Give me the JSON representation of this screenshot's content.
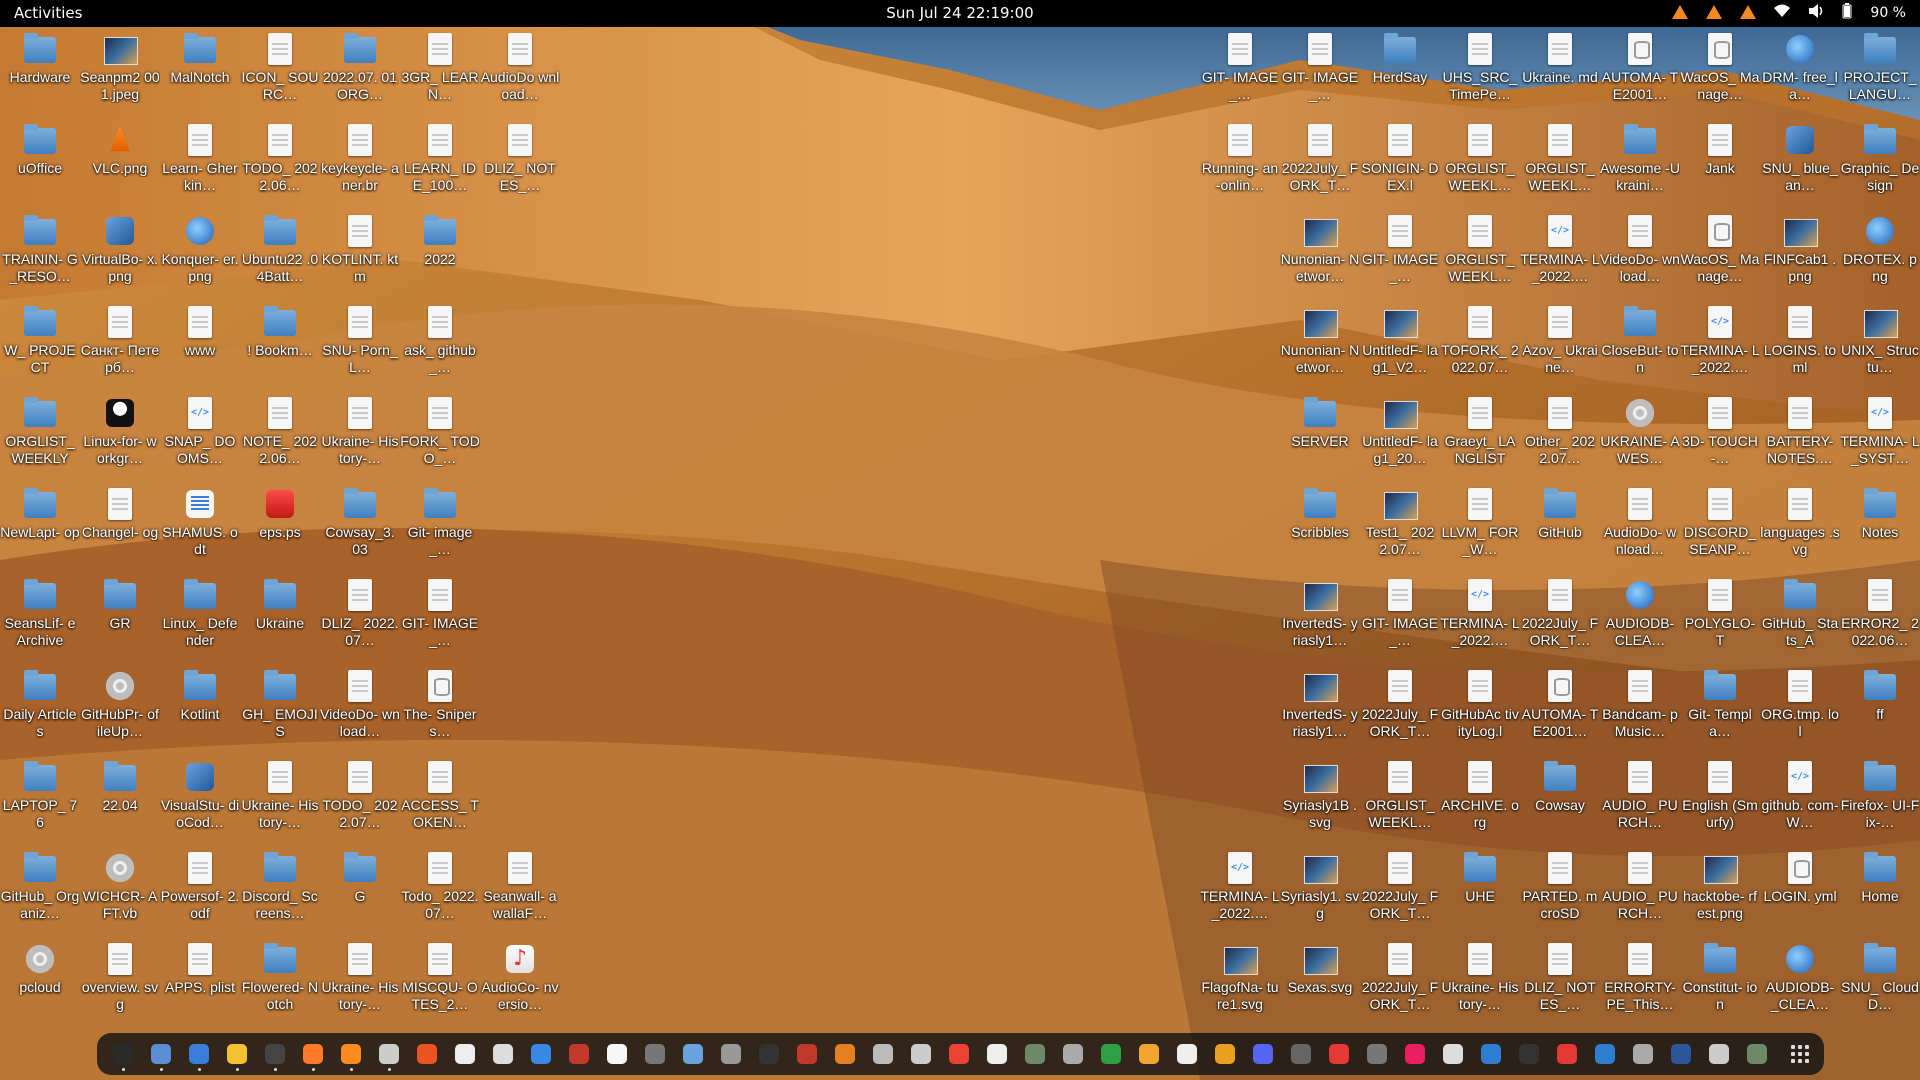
{
  "topbar": {
    "activities": "Activities",
    "clock": "Sun Jul 24  22:19:00",
    "tray_icons": [
      "warning-icon",
      "warning-icon",
      "warning-icon",
      "wifi-icon",
      "volume-icon",
      "battery-icon"
    ],
    "battery": "90 %"
  },
  "colors": {
    "sky": "#3f6d98",
    "sand_light": "#e4a556",
    "sand_dark": "#8f4d1b",
    "dock": "#141414",
    "folder": "#4a8bd0"
  },
  "desktop_left": [
    {
      "label": "Hardware",
      "icon": "folder"
    },
    {
      "label": "Seanpm2 001.jpeg",
      "icon": "image"
    },
    {
      "label": "MalNotch",
      "icon": "folder"
    },
    {
      "label": "ICON_ SOURC…",
      "icon": "doc"
    },
    {
      "label": "2022.07. 01ORG…",
      "icon": "folder"
    },
    {
      "label": "3GR_ LEARN…",
      "icon": "doc"
    },
    {
      "label": "AudioDo wnload…",
      "icon": "doc"
    },
    {
      "label": "uOffice",
      "icon": "folder"
    },
    {
      "label": "VLC.png",
      "icon": "vlc"
    },
    {
      "label": "Learn- Gherkin…",
      "icon": "doc"
    },
    {
      "label": "TODO_ 2022.06…",
      "icon": "doc"
    },
    {
      "label": "keykeycle- aner.br",
      "icon": "doc"
    },
    {
      "label": "LEARN_ IDE_100…",
      "icon": "doc"
    },
    {
      "label": "DLIZ_ NOTES_…",
      "icon": "doc"
    },
    {
      "label": "TRAININ- G_RESO…",
      "icon": "folder"
    },
    {
      "label": "VirtualBo- x.png",
      "icon": "cube"
    },
    {
      "label": "Konquer- er.png",
      "icon": "globe"
    },
    {
      "label": "Ubuntu22 .04Batt…",
      "icon": "folder"
    },
    {
      "label": "KOTLINT. ktm",
      "icon": "doc"
    },
    {
      "label": "2022",
      "icon": "folder"
    },
    {
      "label": "",
      "icon": "none"
    },
    {
      "label": "W_ PROJECT",
      "icon": "folder"
    },
    {
      "label": "Санкт- Петерб…",
      "icon": "doc"
    },
    {
      "label": "www",
      "icon": "doc"
    },
    {
      "label": "! Bookm…",
      "icon": "folder"
    },
    {
      "label": "SNU- Porn_L…",
      "icon": "doc"
    },
    {
      "label": "ask_ github_…",
      "icon": "doc"
    },
    {
      "label": "",
      "icon": "none"
    },
    {
      "label": "ORGLIST_ WEEKLY",
      "icon": "folder"
    },
    {
      "label": "Linux-for- workgr…",
      "icon": "tux"
    },
    {
      "label": "SNAP_ DOOMS…",
      "icon": "code"
    },
    {
      "label": "NOTE_ 2022.06…",
      "icon": "doc"
    },
    {
      "label": "Ukraine- History-…",
      "icon": "doc"
    },
    {
      "label": "FORK_ TODO_…",
      "icon": "doc"
    },
    {
      "label": "",
      "icon": "none"
    },
    {
      "label": "NewLapt- op",
      "icon": "folder"
    },
    {
      "label": "Changel- og",
      "icon": "doc"
    },
    {
      "label": "SHAMUS. odt",
      "icon": "bluedoc"
    },
    {
      "label": "eps.ps",
      "icon": "red"
    },
    {
      "label": "Cowsay_3. 03",
      "icon": "folder"
    },
    {
      "label": "Git- image_…",
      "icon": "folder"
    },
    {
      "label": "",
      "icon": "none"
    },
    {
      "label": "SeansLif- eArchive",
      "icon": "folder"
    },
    {
      "label": "GR",
      "icon": "folder"
    },
    {
      "label": "Linux_ Defender",
      "icon": "folder"
    },
    {
      "label": "Ukraine",
      "icon": "folder"
    },
    {
      "label": "DLIZ_ 2022.07…",
      "icon": "doc"
    },
    {
      "label": "GIT- IMAGE_…",
      "icon": "doc"
    },
    {
      "label": "",
      "icon": "none"
    },
    {
      "label": "Daily Articles",
      "icon": "folder"
    },
    {
      "label": "GitHubPr- ofileUp…",
      "icon": "gear"
    },
    {
      "label": "Kotlint",
      "icon": "folder"
    },
    {
      "label": "GH_ EMOJIS",
      "icon": "folder"
    },
    {
      "label": "VideoDo- wnload…",
      "icon": "doc"
    },
    {
      "label": "The- Snipers…",
      "icon": "db"
    },
    {
      "label": "",
      "icon": "none"
    },
    {
      "label": "LAPTOP_ 76",
      "icon": "folder"
    },
    {
      "label": "22.04",
      "icon": "folder"
    },
    {
      "label": "VisualStu- dioCod…",
      "icon": "cube"
    },
    {
      "label": "Ukraine- History-…",
      "icon": "doc"
    },
    {
      "label": "TODO_ 2022.07…",
      "icon": "doc"
    },
    {
      "label": "ACCESS_ TOKEN…",
      "icon": "doc"
    },
    {
      "label": "",
      "icon": "none"
    },
    {
      "label": "GitHub_ Organiz…",
      "icon": "folder"
    },
    {
      "label": "WICHCR- AFT.vb",
      "icon": "gear"
    },
    {
      "label": "Powersof- 2.odf",
      "icon": "doc"
    },
    {
      "label": "Discord_ Screens…",
      "icon": "folder"
    },
    {
      "label": "G",
      "icon": "folder"
    },
    {
      "label": "Todo_ 2022.07…",
      "icon": "doc"
    },
    {
      "label": "Seanwall- awallaF…",
      "icon": "doc"
    },
    {
      "label": "pcloud",
      "icon": "gear"
    },
    {
      "label": "overview. svg",
      "icon": "doc"
    },
    {
      "label": "APPS. plist",
      "icon": "doc"
    },
    {
      "label": "Flowered- Notch",
      "icon": "folder"
    },
    {
      "label": "Ukraine- History-…",
      "icon": "doc"
    },
    {
      "label": "MISCQU- OTES_2…",
      "icon": "doc"
    },
    {
      "label": "AudioCo- nversio…",
      "icon": "note"
    }
  ],
  "desktop_right": [
    {
      "label": "GIT- IMAGE_…",
      "icon": "doc"
    },
    {
      "label": "GIT- IMAGE_…",
      "icon": "doc"
    },
    {
      "label": "HerdSay",
      "icon": "folder"
    },
    {
      "label": "UHS_SRC_ TimePe…",
      "icon": "doc"
    },
    {
      "label": "Ukraine. md",
      "icon": "doc"
    },
    {
      "label": "AUTOMA- TE2001…",
      "icon": "db"
    },
    {
      "label": "WacOS_ Manage…",
      "icon": "db"
    },
    {
      "label": "DRM- free_la…",
      "icon": "globe"
    },
    {
      "label": "PROJECT_ LANGU…",
      "icon": "folder"
    },
    {
      "label": "Running- an-onlin…",
      "icon": "doc"
    },
    {
      "label": "2022July_ FORK_T…",
      "icon": "doc"
    },
    {
      "label": "SONICIN- DEX.l",
      "icon": "doc"
    },
    {
      "label": "ORGLIST_ WEEKL…",
      "icon": "doc"
    },
    {
      "label": "ORGLIST_ WEEKL…",
      "icon": "doc"
    },
    {
      "label": "Awesome -Ukraini…",
      "icon": "folder"
    },
    {
      "label": "Jank",
      "icon": "doc"
    },
    {
      "label": "SNU_ blue_an…",
      "icon": "cube"
    },
    {
      "label": "Graphic_ Design",
      "icon": "folder"
    },
    {
      "label": "",
      "icon": "none"
    },
    {
      "label": "Nunonian- Networ…",
      "icon": "image"
    },
    {
      "label": "GIT- IMAGE_…",
      "icon": "doc"
    },
    {
      "label": "ORGLIST_ WEEKL…",
      "icon": "doc"
    },
    {
      "label": "TERMINA- L_2022.…",
      "icon": "code"
    },
    {
      "label": "VideoDo- wnload…",
      "icon": "doc"
    },
    {
      "label": "WacOS_ Manage…",
      "icon": "db"
    },
    {
      "label": "FINFCab1 .png",
      "icon": "image"
    },
    {
      "label": "DROTEX. png",
      "icon": "globe"
    },
    {
      "label": "",
      "icon": "none"
    },
    {
      "label": "Nunonian- Networ…",
      "icon": "image"
    },
    {
      "label": "UntitledF- lag1_V2…",
      "icon": "image"
    },
    {
      "label": "TOFORK_ 2022.07…",
      "icon": "doc"
    },
    {
      "label": "Azov_ Ukraine…",
      "icon": "doc"
    },
    {
      "label": "CloseBut- ton",
      "icon": "folder"
    },
    {
      "label": "TERMINA- L_2022.…",
      "icon": "code"
    },
    {
      "label": "LOGINS. toml",
      "icon": "doc"
    },
    {
      "label": "UNIX_ Structu…",
      "icon": "image"
    },
    {
      "label": "",
      "icon": "none"
    },
    {
      "label": "SERVER",
      "icon": "folder"
    },
    {
      "label": "UntitledF- lag1_20…",
      "icon": "image"
    },
    {
      "label": "Graeyt_ LANGLIST",
      "icon": "doc"
    },
    {
      "label": "Other_ 2022.07…",
      "icon": "doc"
    },
    {
      "label": "UKRAINE- AWES…",
      "icon": "gear"
    },
    {
      "label": "3D- TOUCH-…",
      "icon": "doc"
    },
    {
      "label": "BATTERY- NOTES.…",
      "icon": "doc"
    },
    {
      "label": "TERMINA- L_SYST…",
      "icon": "code"
    },
    {
      "label": "",
      "icon": "none"
    },
    {
      "label": "Scribbles",
      "icon": "folder"
    },
    {
      "label": "Test1_ 2022.07…",
      "icon": "image"
    },
    {
      "label": "LLVM_ FOR_W…",
      "icon": "doc"
    },
    {
      "label": "GitHub",
      "icon": "folder"
    },
    {
      "label": "AudioDo- wnload…",
      "icon": "doc"
    },
    {
      "label": "DISCORD_ SEANP…",
      "icon": "doc"
    },
    {
      "label": "languages .svg",
      "icon": "doc"
    },
    {
      "label": "Notes",
      "icon": "folder"
    },
    {
      "label": "",
      "icon": "none"
    },
    {
      "label": "InvertedS- yriasly1…",
      "icon": "image"
    },
    {
      "label": "GIT- IMAGE_…",
      "icon": "doc"
    },
    {
      "label": "TERMINA- L_2022.…",
      "icon": "code"
    },
    {
      "label": "2022July_ FORK_T…",
      "icon": "doc"
    },
    {
      "label": "AUDIODB- CLEA…",
      "icon": "globe"
    },
    {
      "label": "POLYGLO- T",
      "icon": "doc"
    },
    {
      "label": "GitHub_ Stats_A",
      "icon": "folder"
    },
    {
      "label": "ERROR2_ 2022.06…",
      "icon": "doc"
    },
    {
      "label": "",
      "icon": "none"
    },
    {
      "label": "InvertedS- yriasly1…",
      "icon": "image"
    },
    {
      "label": "2022July_ FORK_T…",
      "icon": "doc"
    },
    {
      "label": "GitHubAc tivityLog.l",
      "icon": "doc"
    },
    {
      "label": "AUTOMA- TE2001…",
      "icon": "db"
    },
    {
      "label": "Bandcam- pMusic…",
      "icon": "doc"
    },
    {
      "label": "Git- Templa…",
      "icon": "folder"
    },
    {
      "label": "ORG.tmp. lol",
      "icon": "doc"
    },
    {
      "label": "ff",
      "icon": "folder"
    },
    {
      "label": "",
      "icon": "none"
    },
    {
      "label": "Syriasly1B .svg",
      "icon": "image"
    },
    {
      "label": "ORGLIST_ WEEKL…",
      "icon": "doc"
    },
    {
      "label": "ARCHIVE. org",
      "icon": "doc"
    },
    {
      "label": "Cowsay",
      "icon": "folder"
    },
    {
      "label": "AUDIO_ PURCH…",
      "icon": "doc"
    },
    {
      "label": "English (Smurfy)",
      "icon": "doc"
    },
    {
      "label": "github. com-W…",
      "icon": "code"
    },
    {
      "label": "Firefox- UI-Fix-…",
      "icon": "folder"
    },
    {
      "label": "TERMINA- L_2022.…",
      "icon": "code"
    },
    {
      "label": "Syriasly1. svg",
      "icon": "image"
    },
    {
      "label": "2022July_ FORK_T…",
      "icon": "doc"
    },
    {
      "label": "UHE",
      "icon": "folder"
    },
    {
      "label": "PARTED. mcroSD",
      "icon": "doc"
    },
    {
      "label": "AUDIO_ PURCH…",
      "icon": "doc"
    },
    {
      "label": "hacktobe- rfest.png",
      "icon": "image"
    },
    {
      "label": "LOGIN. yml",
      "icon": "db"
    },
    {
      "label": "Home",
      "icon": "folder"
    },
    {
      "label": "FlagofNa- ture1.svg",
      "icon": "image"
    },
    {
      "label": "Sexas.svg",
      "icon": "image"
    },
    {
      "label": "2022July_ FORK_T…",
      "icon": "doc"
    },
    {
      "label": "Ukraine- History-…",
      "icon": "doc"
    },
    {
      "label": "DLIZ_ NOTES_…",
      "icon": "doc"
    },
    {
      "label": "ERRORTY- PE_This…",
      "icon": "doc"
    },
    {
      "label": "Constitut- ion",
      "icon": "folder"
    },
    {
      "label": "AUDIODB- _CLEA…",
      "icon": "globe"
    },
    {
      "label": "SNU_ CloudD…",
      "icon": "folder"
    }
  ],
  "dock": {
    "items": [
      {
        "name": "terminal",
        "color": "#2b2b2b"
      },
      {
        "name": "files",
        "color": "#5a8fd6"
      },
      {
        "name": "text-editor",
        "color": "#3b7ddd"
      },
      {
        "name": "notes",
        "color": "#f2c230"
      },
      {
        "name": "console",
        "color": "#444444"
      },
      {
        "name": "firefox",
        "color": "#ff7b2a"
      },
      {
        "name": "vlc",
        "color": "#ff8a1e"
      },
      {
        "name": "chromium",
        "color": "#cccccc"
      },
      {
        "name": "software-center",
        "color": "#e95420"
      },
      {
        "name": "writer",
        "color": "#eeeeee"
      },
      {
        "name": "impress",
        "color": "#dddddd"
      },
      {
        "name": "help",
        "color": "#3a88e6"
      },
      {
        "name": "monitor",
        "color": "#c0392b"
      },
      {
        "name": "document",
        "color": "#f6f6f6"
      },
      {
        "name": "tool",
        "color": "#777777"
      },
      {
        "name": "virtualbox",
        "color": "#6aa2e0"
      },
      {
        "name": "disk",
        "color": "#999999"
      },
      {
        "name": "inkscape",
        "color": "#333333"
      },
      {
        "name": "ship",
        "color": "#c0392b"
      },
      {
        "name": "game",
        "color": "#e67e22"
      },
      {
        "name": "archive",
        "color": "#bbbbbb"
      },
      {
        "name": "screenshot",
        "color": "#cccccc"
      },
      {
        "name": "chrome",
        "color": "#ea4335"
      },
      {
        "name": "paper",
        "color": "#eeeeee"
      },
      {
        "name": "gimp",
        "color": "#6c8a68"
      },
      {
        "name": "camera",
        "color": "#aaaaaa"
      },
      {
        "name": "calc",
        "color": "#2ea043"
      },
      {
        "name": "image-viewer",
        "color": "#f2a530"
      },
      {
        "name": "docs",
        "color": "#eeeeee"
      },
      {
        "name": "slides",
        "color": "#e8a020"
      },
      {
        "name": "discord",
        "color": "#5865f2"
      },
      {
        "name": "circle-app",
        "color": "#666666"
      },
      {
        "name": "pdf",
        "color": "#e53935"
      },
      {
        "name": "settings",
        "color": "#777777"
      },
      {
        "name": "media",
        "color": "#e91e63"
      },
      {
        "name": "mail",
        "color": "#dddddd"
      },
      {
        "name": "editor",
        "color": "#2f7dd1"
      },
      {
        "name": "github",
        "color": "#333333"
      },
      {
        "name": "heart",
        "color": "#e53935"
      },
      {
        "name": "office",
        "color": "#2f7dd1"
      },
      {
        "name": "presentation",
        "color": "#aaaaaa"
      },
      {
        "name": "word",
        "color": "#2b579a"
      },
      {
        "name": "record",
        "color": "#cccccc"
      },
      {
        "name": "trash",
        "color": "#6c8a68"
      }
    ],
    "show_apps_label": "Show Applications"
  }
}
